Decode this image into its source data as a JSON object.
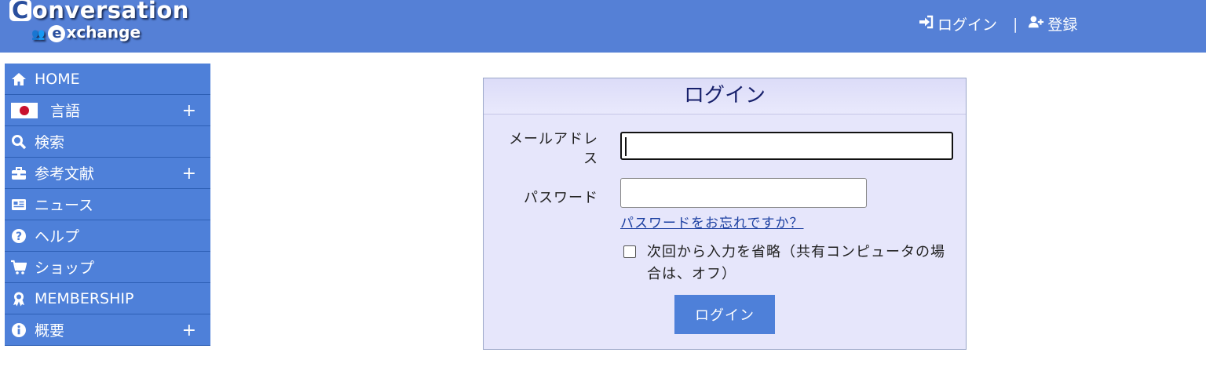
{
  "header": {
    "logo_line1": "onversation",
    "logo_cap": "C",
    "logo_line2": "xchange",
    "logo_cap2": "e",
    "nav_login": "ログイン",
    "nav_sep": "|",
    "nav_register": "登録"
  },
  "sidebar": {
    "items": [
      {
        "label": "HOME",
        "icon": "home-icon"
      },
      {
        "label": "言語",
        "icon": "japan-flag-icon",
        "expand": "+"
      },
      {
        "label": "検索",
        "icon": "search-icon"
      },
      {
        "label": "参考文献",
        "icon": "toolbox-icon",
        "expand": "+"
      },
      {
        "label": "ニュース",
        "icon": "newspaper-icon"
      },
      {
        "label": "ヘルプ",
        "icon": "question-circle-icon"
      },
      {
        "label": "ショップ",
        "icon": "cart-icon"
      },
      {
        "label": "MEMBERSHIP",
        "icon": "award-icon"
      },
      {
        "label": "概要",
        "icon": "info-circle-icon",
        "expand": "+"
      }
    ]
  },
  "login": {
    "title": "ログイン",
    "email_label_1": "メールアドレ",
    "email_label_2": "ス",
    "email_value": "",
    "password_label": "パスワード",
    "password_value": "",
    "forgot_link": "パスワードをお忘れですか？",
    "remember_label": "次回から入力を省略（共有コンピュータの場合は、オフ）",
    "remember_checked": false,
    "submit": "ログイン"
  },
  "colors": {
    "header_bg": "#5580d6",
    "sidebar_bg": "#4e80d9",
    "panel_bg": "#e6e6fb",
    "button_bg": "#4e80d9",
    "link": "#1b3fa1"
  }
}
